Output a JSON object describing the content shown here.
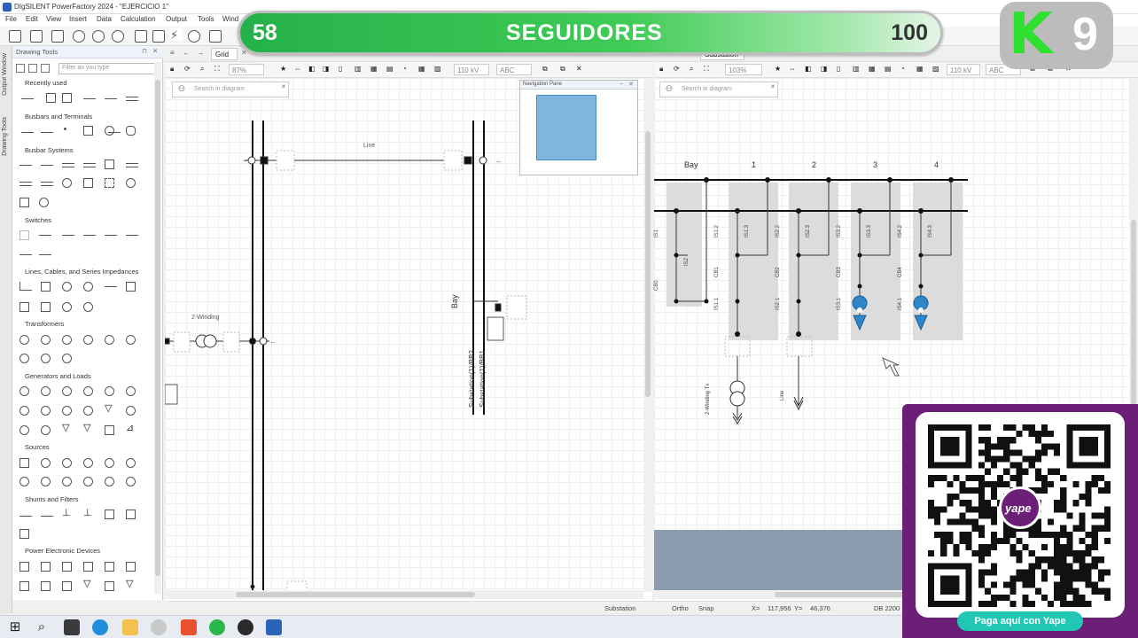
{
  "window": {
    "title": "DIgSILENT PowerFactory 2024 - \"EJERCICIO 1\"",
    "menu": [
      "File",
      "Edit",
      "View",
      "Insert",
      "Data",
      "Calculation",
      "Output",
      "Tools",
      "Wind"
    ]
  },
  "left_panel": {
    "vertical_tabs": [
      "Output Window",
      "Drawing Tools"
    ],
    "title": "Drawing Tools",
    "filter_placeholder": "Filter as you type",
    "sections": [
      "Recently used",
      "Busbars and Terminals",
      "Busbar Systems",
      "Switches",
      "Lines, Cables, and Series Impedances",
      "Transformers",
      "Generators and Loads",
      "Sources",
      "Shunts and Filters",
      "Power Electronic Devices"
    ]
  },
  "grid_diagram": {
    "tab_label": "Grid",
    "zoom": "87%",
    "voltage": "110 kV",
    "text_style": "ABC",
    "search_placeholder": "Search in diagram",
    "navigation_pane_title": "Navigation Pane",
    "labels": {
      "line": "Line",
      "two_winding": "2-Winding",
      "bay": "Bay",
      "bus_a": "Substation(1)/BB2",
      "bus_b": "Substation(1)/BB1"
    }
  },
  "substation_diagram": {
    "tab_label": "Substation",
    "zoom": "103%",
    "voltage": "110 kV",
    "text_style": "ABC",
    "search_placeholder": "Search in diagram",
    "bay_headers": [
      "Bay",
      "1",
      "2",
      "3",
      "4"
    ],
    "labels": {
      "is1": "IS1",
      "is2": "IS2",
      "cb0": "CB0",
      "b1": [
        "IS1.2",
        "IS1.3",
        "CB1",
        "IS1.1"
      ],
      "b2": [
        "IS2.2",
        "IS2.3",
        "CB2",
        "IS2.1"
      ],
      "b3": [
        "IS3.2",
        "IS3.3",
        "CB3",
        "IS3.1"
      ],
      "b4": [
        "IS4.2",
        "IS4.3",
        "CB4",
        "IS4.1"
      ],
      "two_winding": "2-Winding Tx",
      "line": "Line"
    }
  },
  "overlays": {
    "followers_current": "58",
    "followers_label": "SEGUIDORES",
    "followers_goal": "100",
    "followers_progress": 0.58,
    "logo_letter": "K",
    "logo_number": "9",
    "yape_button": "Paga aquí con Yape",
    "yape_logo": "yape"
  },
  "status_bar": {
    "context": "Substation",
    "ortho": "Ortho",
    "snap": "Snap",
    "x_label": "X=",
    "x_value": "117,956",
    "y_label": "Y=",
    "y_value": "46,376",
    "db": "DB 2200"
  },
  "colors": {
    "accent_green": "#3fcb55",
    "yape_purple": "#6b1f77",
    "yape_teal": "#21c7b5",
    "marker_blue": "#2e86c9",
    "nav_blue": "#7fb6e0"
  }
}
